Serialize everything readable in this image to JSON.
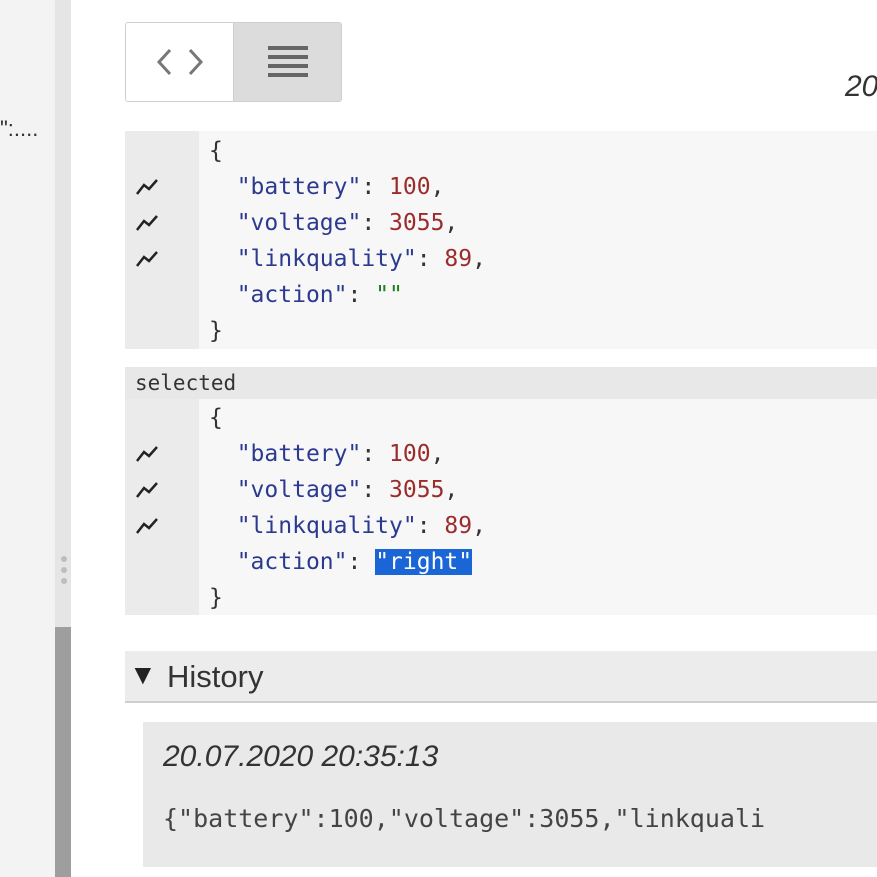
{
  "sidebar": {
    "snippet": "\":...."
  },
  "toolbar": {
    "code_view_icon": "code-brackets-icon",
    "list_view_icon": "list-lines-icon",
    "corner_text": "20"
  },
  "current_panel": {
    "open_brace": "{",
    "close_brace": "}",
    "rows": [
      {
        "key": "\"battery\"",
        "sep": ": ",
        "value": "100",
        "tail": ",",
        "type": "num"
      },
      {
        "key": "\"voltage\"",
        "sep": ": ",
        "value": "3055",
        "tail": ",",
        "type": "num"
      },
      {
        "key": "\"linkquality\"",
        "sep": ": ",
        "value": "89",
        "tail": ",",
        "type": "num"
      },
      {
        "key": "\"action\"",
        "sep": ": ",
        "value": "\"\"",
        "tail": "",
        "type": "str"
      }
    ]
  },
  "selected_panel": {
    "label": "selected",
    "open_brace": "{",
    "close_brace": "}",
    "rows": [
      {
        "key": "\"battery\"",
        "sep": ": ",
        "value": "100",
        "tail": ",",
        "type": "num"
      },
      {
        "key": "\"voltage\"",
        "sep": ": ",
        "value": "3055",
        "tail": ",",
        "type": "num"
      },
      {
        "key": "\"linkquality\"",
        "sep": ": ",
        "value": "89",
        "tail": ",",
        "type": "num"
      },
      {
        "key": "\"action\"",
        "sep": ": ",
        "value": "\"right\"",
        "tail": "",
        "type": "sel"
      }
    ]
  },
  "history": {
    "toggle_glyph": "▼",
    "title": "History",
    "entries": [
      {
        "timestamp": "20.07.2020 20:35:13",
        "json": "{\"battery\":100,\"voltage\":3055,\"linkquali"
      }
    ]
  },
  "colors": {
    "selection": "#1a66d6",
    "key": "#2b3a8f",
    "number": "#9b2c2c",
    "string": "#1a7f1a"
  }
}
